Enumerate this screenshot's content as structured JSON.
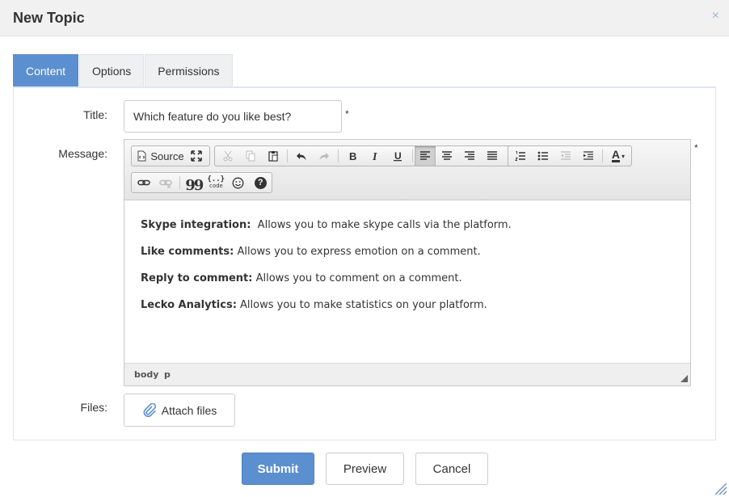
{
  "dialog": {
    "title": "New Topic",
    "close_symbol": "×"
  },
  "tabs": [
    {
      "label": "Content",
      "active": true
    },
    {
      "label": "Options",
      "active": false
    },
    {
      "label": "Permissions",
      "active": false
    }
  ],
  "form": {
    "title_label": "Title:",
    "title_value": "Which feature do you like best?",
    "message_label": "Message:",
    "files_label": "Files:",
    "required_mark": "*",
    "attach_label": "Attach files"
  },
  "editor": {
    "source_label": "Source",
    "font_color_letter": "A",
    "code_label": "code",
    "quote_glyph": "99",
    "help_glyph": "?",
    "paragraphs": [
      {
        "bold": "Skype integration:",
        "text": "  Allows you to make skype calls via the platform."
      },
      {
        "bold": "Like comments:",
        "text": " Allows you to express emotion on a comment."
      },
      {
        "bold": "Reply to comment:",
        "text": " Allows you to comment on a comment."
      },
      {
        "bold": "Lecko Analytics:",
        "text": " Allows you to make statistics on your platform."
      }
    ],
    "path": [
      "body",
      "p"
    ]
  },
  "actions": {
    "submit": "Submit",
    "preview": "Preview",
    "cancel": "Cancel"
  },
  "colors": {
    "accent": "#5b8fcf",
    "header_bg": "#f1f1f1"
  }
}
